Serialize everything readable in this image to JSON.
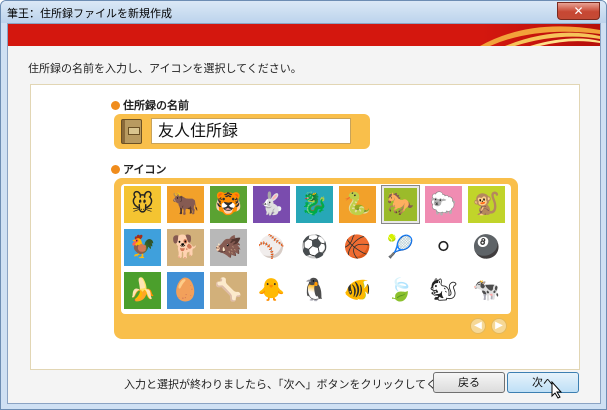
{
  "window": {
    "title": "筆王：住所録ファイルを新規作成",
    "close_label": "✕"
  },
  "instruction": "住所録の名前を入力し、アイコンを選択してください。",
  "name_section": {
    "label": "住所録の名前",
    "value": "友人住所録"
  },
  "icon_section": {
    "label": "アイコン",
    "rows": [
      [
        {
          "name": "mouse-icon",
          "glyph": "🐭",
          "bg": "bg-yellow"
        },
        {
          "name": "cow-icon",
          "glyph": "🐂",
          "bg": "bg-orange"
        },
        {
          "name": "tiger-icon",
          "glyph": "🐯",
          "bg": "bg-green"
        },
        {
          "name": "rabbit-icon",
          "glyph": "🐇",
          "bg": "bg-purple"
        },
        {
          "name": "dragon-icon",
          "glyph": "🐉",
          "bg": "bg-teal"
        },
        {
          "name": "snake-icon",
          "glyph": "🐍",
          "bg": "bg-orange"
        },
        {
          "name": "horse-icon",
          "glyph": "🐎",
          "bg": "bg-olive",
          "selected": true
        },
        {
          "name": "sheep-icon",
          "glyph": "🐑",
          "bg": "bg-pink"
        },
        {
          "name": "monkey-icon",
          "glyph": "🐒",
          "bg": "bg-lime"
        }
      ],
      [
        {
          "name": "rooster-icon",
          "glyph": "🐓",
          "bg": "bg-sky"
        },
        {
          "name": "dog-icon",
          "glyph": "🐕",
          "bg": "bg-tan"
        },
        {
          "name": "boar-icon",
          "glyph": "🐗",
          "bg": "bg-grey"
        },
        {
          "name": "baseball-icon",
          "glyph": "⚾",
          "bg": ""
        },
        {
          "name": "soccer-ball-icon",
          "glyph": "⚽",
          "bg": ""
        },
        {
          "name": "basketball-icon",
          "glyph": "🏀",
          "bg": ""
        },
        {
          "name": "tennis-ball-icon",
          "glyph": "🎾",
          "bg": ""
        },
        {
          "name": "golf-ball-icon",
          "glyph": "⚪",
          "bg": ""
        },
        {
          "name": "billiard-ball-icon",
          "glyph": "🎱",
          "bg": ""
        }
      ],
      [
        {
          "name": "banana-icon",
          "glyph": "🍌",
          "bg": "bg-leafgreen"
        },
        {
          "name": "egg-icon",
          "glyph": "🥚",
          "bg": "bg-blue"
        },
        {
          "name": "bone-icon",
          "glyph": "🦴",
          "bg": "bg-tan"
        },
        {
          "name": "chick-icon",
          "glyph": "🐥",
          "bg": ""
        },
        {
          "name": "penguin-icon",
          "glyph": "🐧",
          "bg": ""
        },
        {
          "name": "fish-icon",
          "glyph": "🐠",
          "bg": ""
        },
        {
          "name": "leaf-icon",
          "glyph": "🍃",
          "bg": ""
        },
        {
          "name": "squirrel-icon",
          "glyph": "🐿",
          "bg": ""
        },
        {
          "name": "cow-spotted-icon",
          "glyph": "🐄",
          "bg": ""
        }
      ]
    ],
    "prev_glyph": "◀",
    "next_glyph": "▶"
  },
  "footer": {
    "message": "入力と選択が終わりましたら、「次へ」ボタンをクリックしてください。",
    "back_label": "戻る",
    "next_label": "次へ"
  }
}
